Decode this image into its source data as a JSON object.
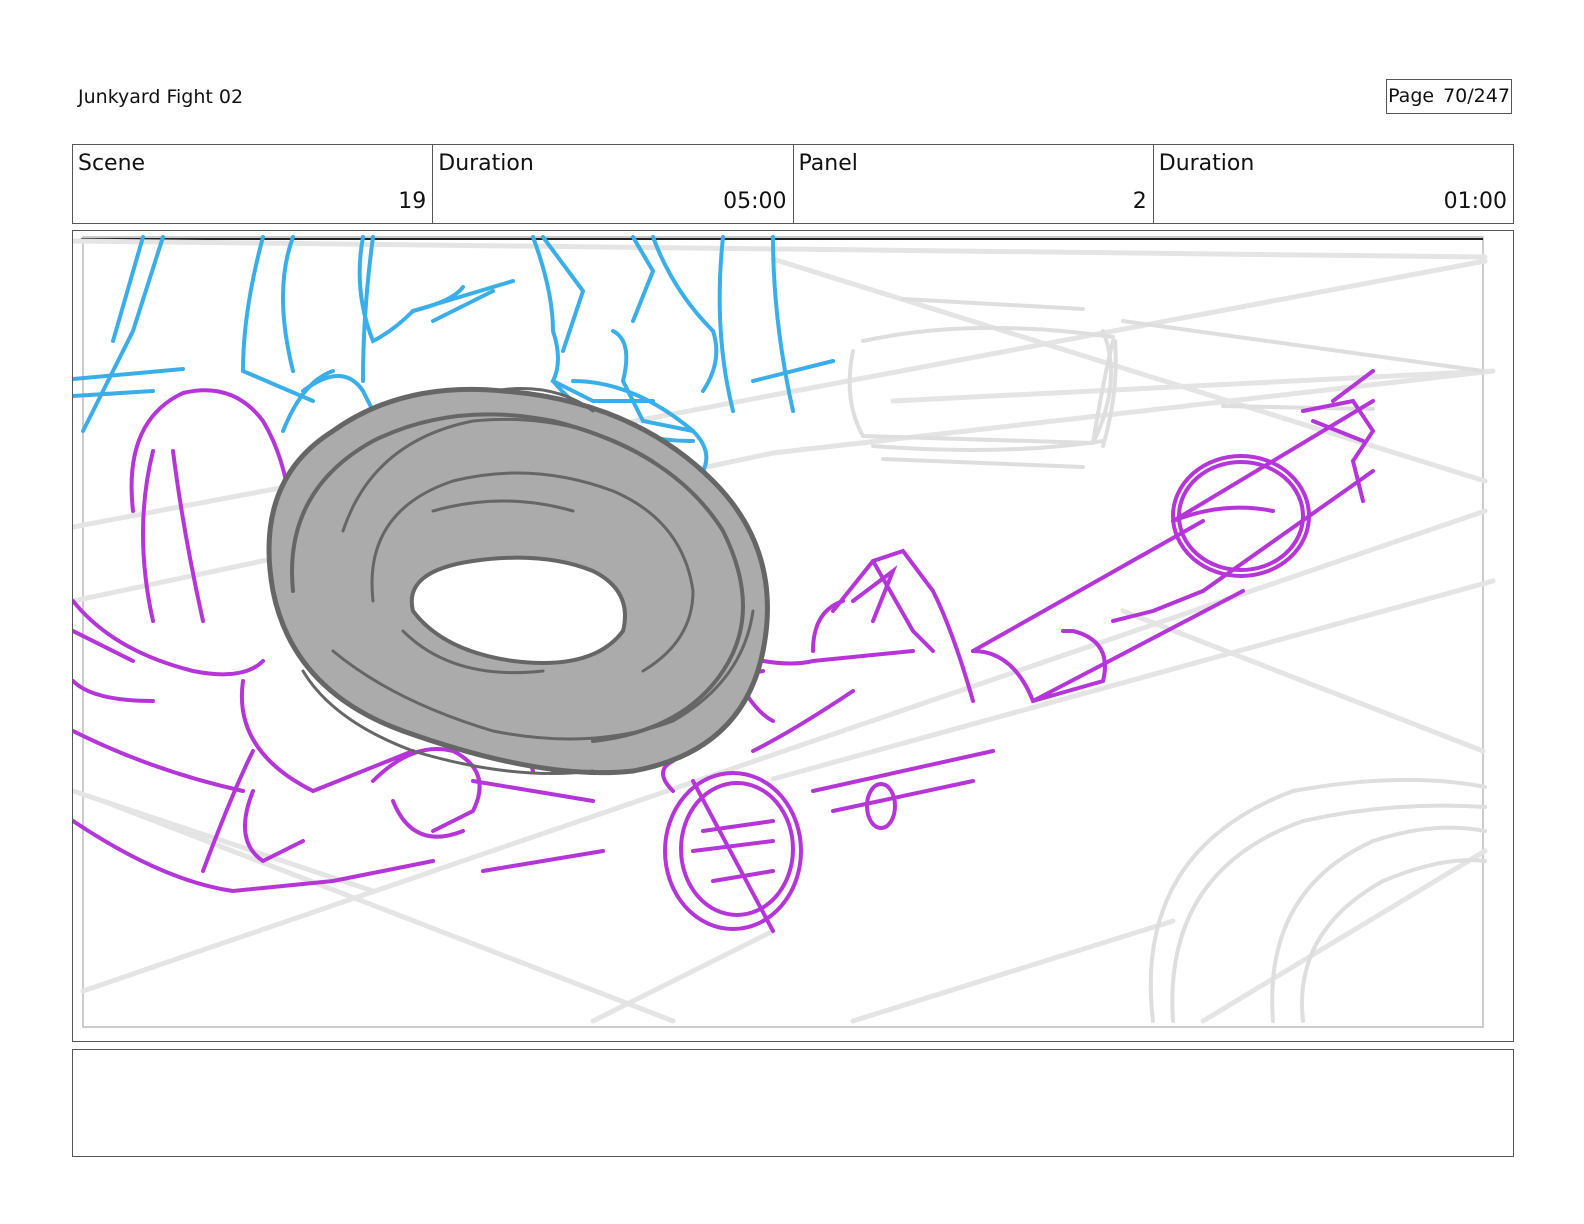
{
  "header": {
    "title": "Junkyard Fight 02",
    "page_label": "Page",
    "page_value": "70/247"
  },
  "info": {
    "scene_label": "Scene",
    "scene_value": "19",
    "scene_duration_label": "Duration",
    "scene_duration_value": "05:00",
    "panel_label": "Panel",
    "panel_value": "2",
    "panel_duration_label": "Duration",
    "panel_duration_value": "01:00"
  },
  "sketch": {
    "background_color": "#dedede",
    "bg_line_color": "#e4e4e4",
    "blue_color": "#3aaee8",
    "magenta_color": "#b535d8",
    "tire_fill": "#ababab",
    "tire_stroke": "#666666"
  },
  "notes": {
    "text": ""
  }
}
